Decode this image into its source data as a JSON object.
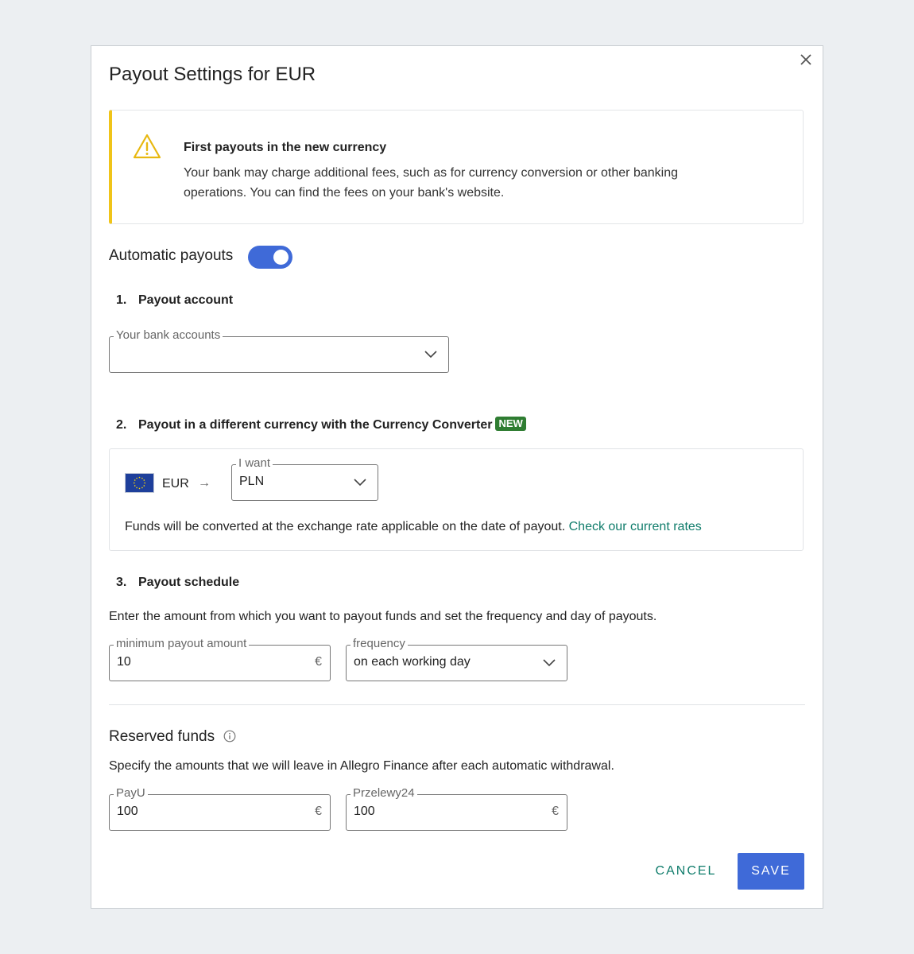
{
  "modal": {
    "title": "Payout Settings for EUR",
    "alert": {
      "title": "First payouts in the new currency",
      "text": "Your bank may charge additional fees, such as for currency conversion or other banking operations. You can find the fees on your bank's website."
    },
    "automatic_payouts": {
      "label": "Automatic payouts",
      "enabled": true,
      "accent_color": "#3f6ad8"
    },
    "section1": {
      "number": "1.",
      "title": "Payout account",
      "bank_accounts": {
        "legend": "Your bank accounts",
        "value": ""
      }
    },
    "section2": {
      "number": "2.",
      "title": "Payout in a different currency with the Currency Converter",
      "badge": "NEW",
      "from_currency": "EUR",
      "arrow": "→",
      "target": {
        "legend": "I want",
        "value": "PLN"
      },
      "note": "Funds will be converted at the exchange rate applicable on the date of payout.",
      "link": "Check our current rates"
    },
    "section3": {
      "number": "3.",
      "title": "Payout schedule",
      "description": "Enter the amount from which you want to payout funds and set the frequency and day of payouts.",
      "min_amount": {
        "legend": "minimum payout amount",
        "value": "10",
        "suffix": "€"
      },
      "frequency": {
        "legend": "frequency",
        "value": "on each working day"
      }
    },
    "reserved": {
      "title": "Reserved funds",
      "description": "Specify the amounts that we will leave in Allegro Finance after each automatic withdrawal.",
      "payu": {
        "legend": "PayU",
        "value": "100",
        "suffix": "€"
      },
      "przelewy24": {
        "legend": "Przelewy24",
        "value": "100",
        "suffix": "€"
      }
    },
    "buttons": {
      "cancel": "CANCEL",
      "save": "SAVE"
    }
  }
}
